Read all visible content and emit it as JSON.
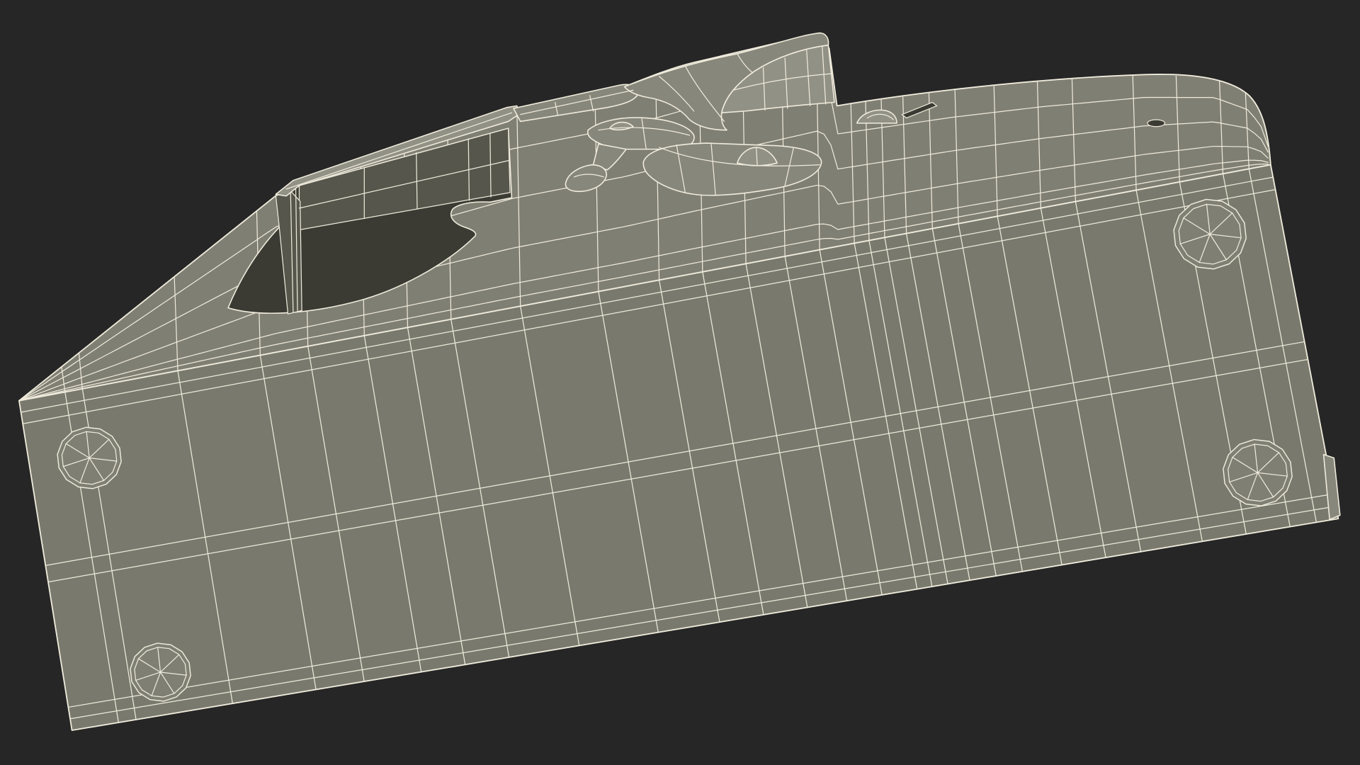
{
  "colors": {
    "background": "#262626",
    "front_surface": "#797a6d",
    "top_surface": "#807f73",
    "parts": "#88877b",
    "parts_light": "#929185",
    "interior": "#3b3b34",
    "interior_wall": "#56564c",
    "screw": "#7f7f73",
    "wireframe": "#efebdc"
  }
}
